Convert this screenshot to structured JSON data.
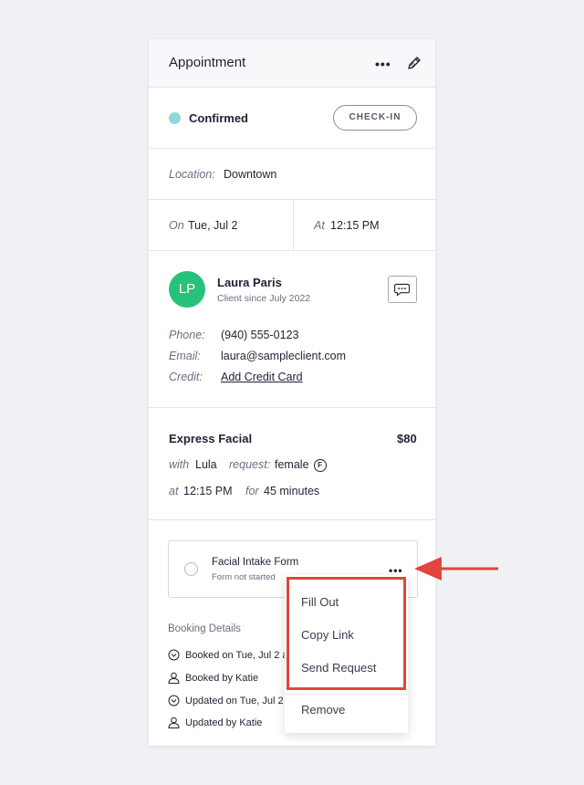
{
  "header": {
    "title": "Appointment",
    "more_icon": "ellipsis-icon",
    "edit_icon": "pencil-icon"
  },
  "status": {
    "label": "Confirmed",
    "color": "#8fd9dd",
    "checkin_label": "CHECK-IN"
  },
  "location": {
    "label": "Location:",
    "value": "Downtown"
  },
  "datetime": {
    "on_label": "On",
    "date": "Tue, Jul 2",
    "at_label": "At",
    "time": "12:15 PM"
  },
  "client": {
    "initials": "LP",
    "name": "Laura Paris",
    "since": "Client since July 2022",
    "avatar_color": "#27c27a",
    "phone_label": "Phone:",
    "phone": "(940) 555-0123",
    "email_label": "Email:",
    "email": "laura@sampleclient.com",
    "credit_label": "Credit:",
    "credit_link": "Add Credit Card"
  },
  "service": {
    "name": "Express Facial",
    "price": "$80",
    "with_label": "with",
    "staff": "Lula",
    "request_label": "request:",
    "request": "female",
    "request_badge": "F",
    "at_label": "at",
    "time": "12:15 PM",
    "for_label": "for",
    "duration": "45 minutes"
  },
  "form": {
    "name": "Facial Intake Form",
    "status": "Form not started"
  },
  "booking": {
    "title": "Booking Details",
    "booked_on": "Booked on Tue, Jul 2 a",
    "booked_by": "Booked by Katie",
    "updated_on": "Updated on Tue, Jul 2",
    "updated_by": "Updated by Katie"
  },
  "menu": {
    "items": [
      "Fill Out",
      "Copy Link",
      "Send Request",
      "Remove"
    ]
  },
  "annotation": {
    "color": "#e2453c"
  }
}
